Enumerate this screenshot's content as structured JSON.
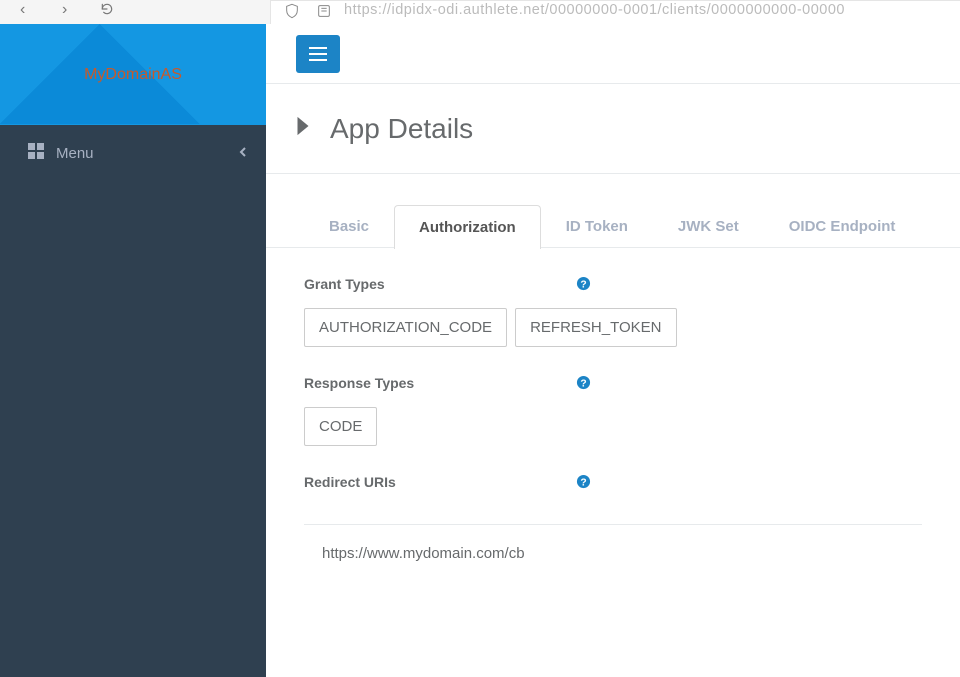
{
  "browser": {
    "url_placeholder": "https://idpidx-odi.authlete.net/00000000-0001/clients/0000000000-00000"
  },
  "sidebar": {
    "brand": "MyDomainAS",
    "menu_label": "Menu"
  },
  "page": {
    "title": "App Details"
  },
  "tabs": [
    {
      "label": "Basic"
    },
    {
      "label": "Authorization"
    },
    {
      "label": "ID Token"
    },
    {
      "label": "JWK Set"
    },
    {
      "label": "OIDC Endpoint"
    }
  ],
  "active_tab_index": 1,
  "authorization_form": {
    "grant_types": {
      "label": "Grant Types",
      "chips": [
        "AUTHORIZATION_CODE",
        "REFRESH_TOKEN"
      ]
    },
    "response_types": {
      "label": "Response Types",
      "chips": [
        "CODE"
      ]
    },
    "redirect_uris": {
      "label": "Redirect URIs",
      "values": [
        "https://www.mydomain.com/cb"
      ]
    }
  },
  "colors": {
    "accent": "#1c84c6"
  }
}
